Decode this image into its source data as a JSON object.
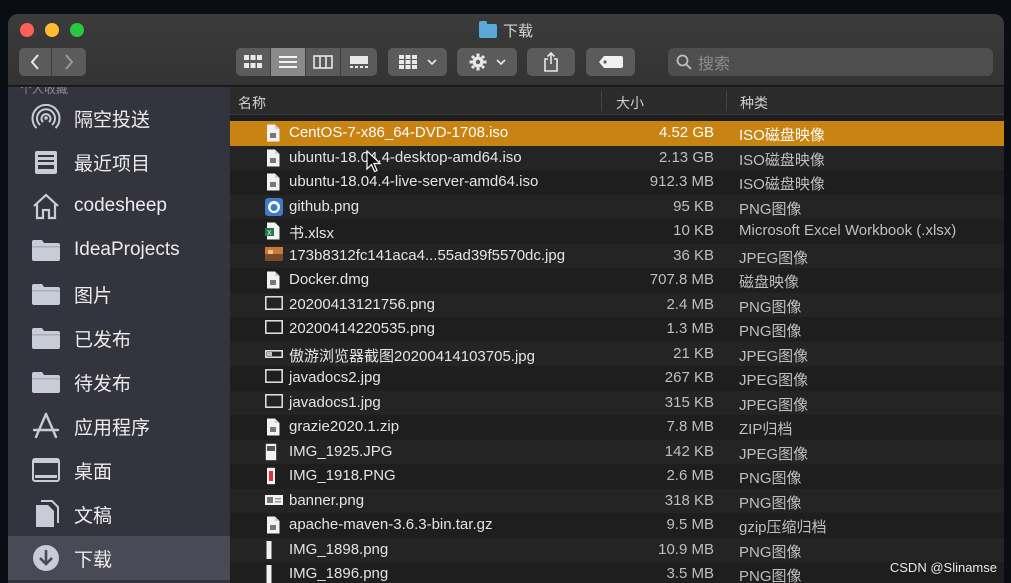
{
  "window": {
    "title": "下载"
  },
  "search": {
    "placeholder": "搜索"
  },
  "sidebar": {
    "section_label_cut": "个人收藏",
    "items": [
      {
        "label": "隔空投送",
        "icon": "airdrop-icon"
      },
      {
        "label": "最近项目",
        "icon": "recents-icon"
      },
      {
        "label": "codesheep",
        "icon": "home-icon"
      },
      {
        "label": "IdeaProjects",
        "icon": "folder-icon"
      },
      {
        "label": "图片",
        "icon": "folder-icon"
      },
      {
        "label": "已发布",
        "icon": "folder-icon"
      },
      {
        "label": "待发布",
        "icon": "folder-icon"
      },
      {
        "label": "应用程序",
        "icon": "applications-icon"
      },
      {
        "label": "桌面",
        "icon": "desktop-icon"
      },
      {
        "label": "文稿",
        "icon": "documents-icon"
      },
      {
        "label": "下载",
        "icon": "downloads-icon",
        "selected": true
      }
    ]
  },
  "columns": {
    "name": "名称",
    "size": "大小",
    "kind": "种类"
  },
  "files": [
    {
      "name": "CentOS-7-x86_64-DVD-1708.iso",
      "size": "4.52 GB",
      "kind": "ISO磁盘映像",
      "icon": "doc",
      "selected": true
    },
    {
      "name": "ubuntu-18.04.4-desktop-amd64.iso",
      "size": "2.13 GB",
      "kind": "ISO磁盘映像",
      "icon": "doc"
    },
    {
      "name": "ubuntu-18.04.4-live-server-amd64.iso",
      "size": "912.3 MB",
      "kind": "ISO磁盘映像",
      "icon": "doc"
    },
    {
      "name": "github.png",
      "size": "95 KB",
      "kind": "PNG图像",
      "icon": "github"
    },
    {
      "name": "书.xlsx",
      "size": "10 KB",
      "kind": "Microsoft Excel Workbook (.xlsx)",
      "icon": "excel"
    },
    {
      "name": "173b8312fc141aca4...55ad39f5570dc.jpg",
      "size": "36 KB",
      "kind": "JPEG图像",
      "icon": "photo"
    },
    {
      "name": "Docker.dmg",
      "size": "707.8 MB",
      "kind": "磁盘映像",
      "icon": "doc"
    },
    {
      "name": "20200413121756.png",
      "size": "2.4 MB",
      "kind": "PNG图像",
      "icon": "screen"
    },
    {
      "name": "20200414220535.png",
      "size": "1.3 MB",
      "kind": "PNG图像",
      "icon": "screen"
    },
    {
      "name": "傲游浏览器截图20200414103705.jpg",
      "size": "21 KB",
      "kind": "JPEG图像",
      "icon": "wide"
    },
    {
      "name": "javadocs2.jpg",
      "size": "267 KB",
      "kind": "JPEG图像",
      "icon": "screen"
    },
    {
      "name": "javadocs1.jpg",
      "size": "315 KB",
      "kind": "JPEG图像",
      "icon": "screen"
    },
    {
      "name": "grazie2020.1.zip",
      "size": "7.8 MB",
      "kind": "ZIP归档",
      "icon": "doc"
    },
    {
      "name": "IMG_1925.JPG",
      "size": "142 KB",
      "kind": "JPEG图像",
      "icon": "phone"
    },
    {
      "name": "IMG_1918.PNG",
      "size": "2.6 MB",
      "kind": "PNG图像",
      "icon": "phone-red"
    },
    {
      "name": "banner.png",
      "size": "318 KB",
      "kind": "PNG图像",
      "icon": "banner"
    },
    {
      "name": "apache-maven-3.6.3-bin.tar.gz",
      "size": "9.5 MB",
      "kind": "gzip压缩归档",
      "icon": "doc"
    },
    {
      "name": "IMG_1898.png",
      "size": "10.9 MB",
      "kind": "PNG图像",
      "icon": "thin"
    },
    {
      "name": "IMG_1896.png",
      "size": "3.5 MB",
      "kind": "PNG图像",
      "icon": "thin"
    }
  ],
  "watermark": "CSDN @Slinamse",
  "colors": {
    "selection": "#c98312",
    "sidebar": "#34343f",
    "folder_blue": "#59a8d6"
  }
}
